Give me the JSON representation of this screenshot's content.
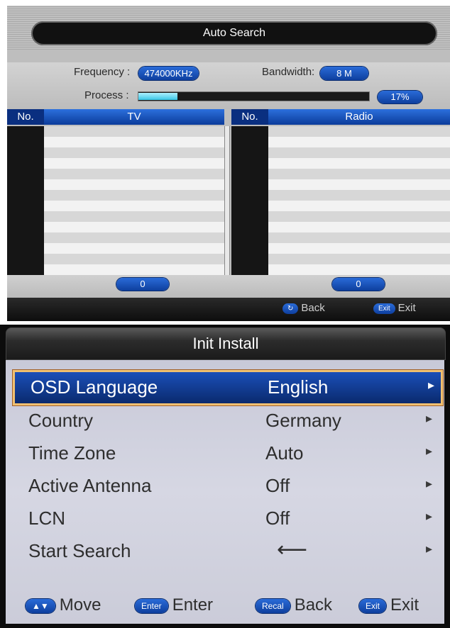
{
  "auto_search": {
    "title": "Auto Search",
    "frequency_label": "Frequency :",
    "frequency_value": "474000KHz",
    "bandwidth_label": "Bandwidth:",
    "bandwidth_value": "8 M",
    "process_label": "Process :",
    "progress_percent": 17,
    "progress_text": "17%",
    "tv": {
      "no_header": "No.",
      "name_header": "TV",
      "count": "0"
    },
    "radio": {
      "no_header": "No.",
      "name_header": "Radio",
      "count": "0"
    },
    "footer": {
      "back_key": "↻",
      "back_label": "Back",
      "exit_key": "Exit",
      "exit_label": "Exit"
    }
  },
  "init_install": {
    "title": "Init Install",
    "items": [
      {
        "label": "OSD Language",
        "value": "English",
        "selected": true
      },
      {
        "label": "Country",
        "value": "Germany"
      },
      {
        "label": "Time Zone",
        "value": "Auto"
      },
      {
        "label": "Active Antenna",
        "value": "Off"
      },
      {
        "label": "LCN",
        "value": "Off"
      },
      {
        "label": "Start Search",
        "value": "⟵"
      }
    ],
    "arrow": "▸",
    "footer": {
      "move_key": "▲▼",
      "move_label": "Move",
      "enter_key": "Enter",
      "enter_label": "Enter",
      "recall_key": "Recal",
      "back_label": "Back",
      "exit_key": "Exit",
      "exit_label": "Exit"
    }
  },
  "colors": {
    "accent_blue": "#1b4fb8",
    "highlight_border": "#f0c070",
    "progress_fill": "#38c6e6"
  }
}
